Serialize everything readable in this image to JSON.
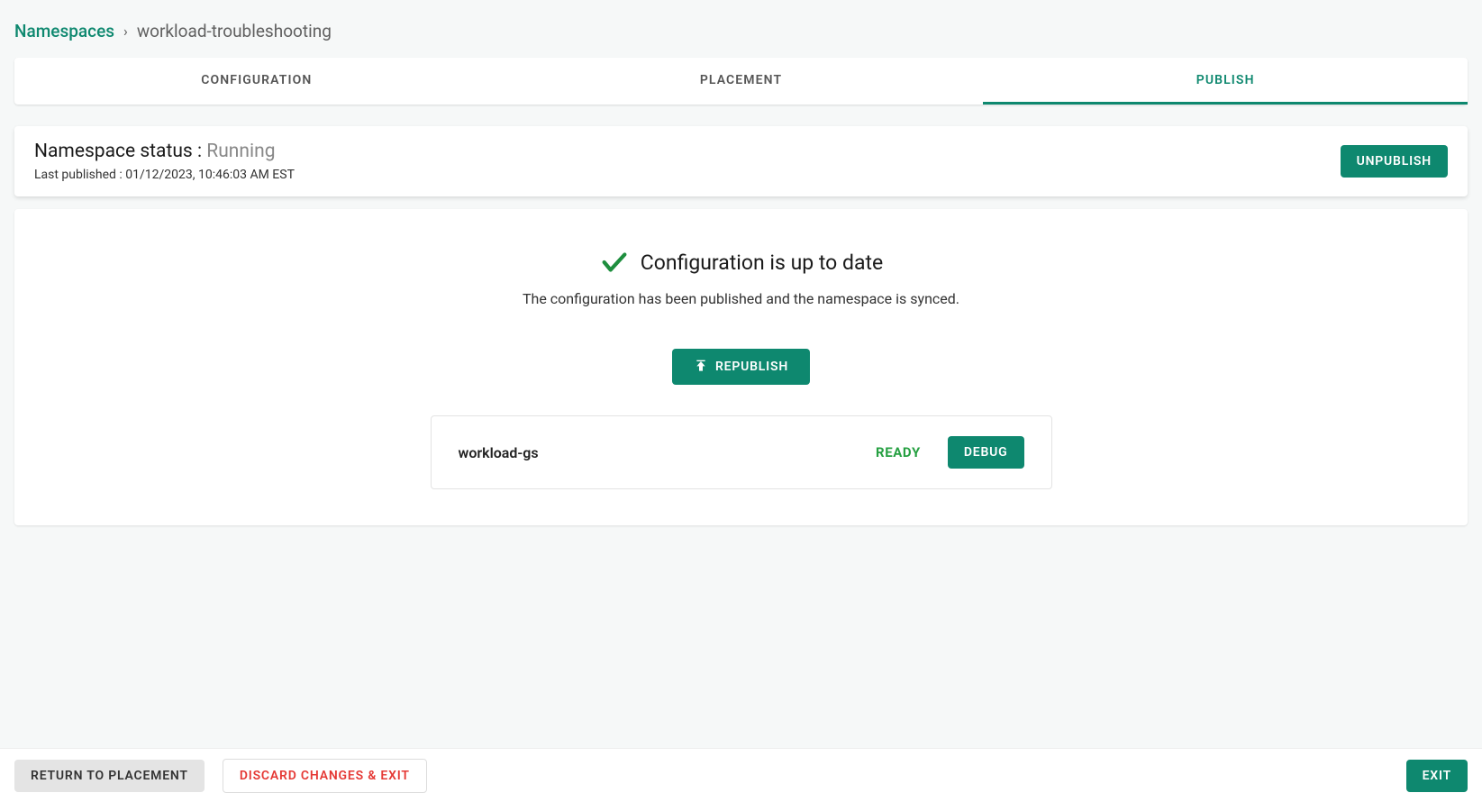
{
  "breadcrumb": {
    "root": "Namespaces",
    "separator": "›",
    "current": "workload-troubleshooting"
  },
  "tabs": {
    "configuration": "CONFIGURATION",
    "placement": "PLACEMENT",
    "publish": "PUBLISH"
  },
  "status": {
    "label": "Namespace status : ",
    "value": "Running",
    "last_published_label": "Last published : ",
    "last_published_value": "01/12/2023, 10:46:03 AM EST",
    "unpublish_button": "UNPUBLISH"
  },
  "main": {
    "heading": "Configuration is up to date",
    "subtext": "The configuration has been published and the namespace is synced.",
    "republish_button": "REPUBLISH"
  },
  "workload": {
    "name": "workload-gs",
    "status": "READY",
    "debug_button": "DEBUG"
  },
  "footer": {
    "return_button": "RETURN TO PLACEMENT",
    "discard_button": "DISCARD CHANGES & EXIT",
    "exit_button": "EXIT"
  }
}
